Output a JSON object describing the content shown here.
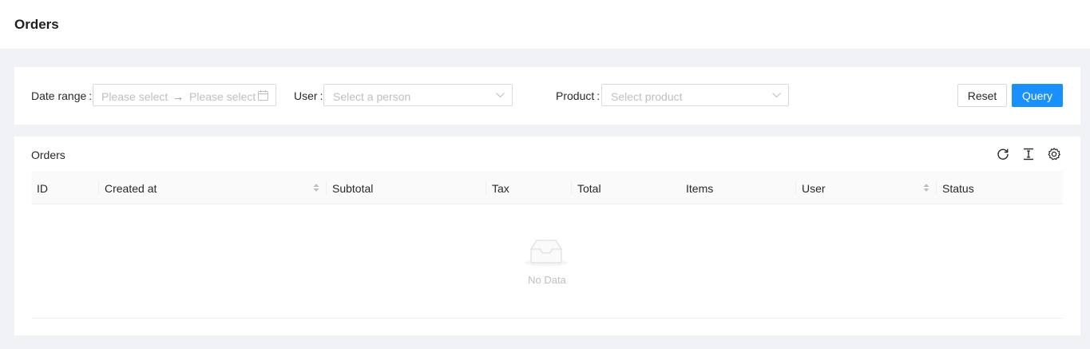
{
  "header": {
    "title": "Orders"
  },
  "filters": {
    "date_range": {
      "label": "Date range",
      "colon": ":",
      "start_placeholder": "Please select",
      "end_placeholder": "Please select",
      "separator": "→"
    },
    "user": {
      "label": "User",
      "colon": ":",
      "placeholder": "Select a person"
    },
    "product": {
      "label": "Product",
      "colon": ":",
      "placeholder": "Select product"
    },
    "reset_label": "Reset",
    "query_label": "Query"
  },
  "table": {
    "title": "Orders",
    "toolbar": [
      "reload-icon",
      "column-height-icon",
      "setting-icon"
    ],
    "columns": [
      {
        "label": "ID",
        "sortable": false
      },
      {
        "label": "Created at",
        "sortable": true
      },
      {
        "label": "Subtotal",
        "sortable": false
      },
      {
        "label": "Tax",
        "sortable": false
      },
      {
        "label": "Total",
        "sortable": false
      },
      {
        "label": "Items",
        "sortable": false
      },
      {
        "label": "User",
        "sortable": true
      },
      {
        "label": "Status",
        "sortable": false
      }
    ],
    "empty_text": "No Data"
  },
  "colors": {
    "primary": "#1890ff",
    "page_bg": "#f0f2f5",
    "placeholder": "#bfbfbf"
  }
}
